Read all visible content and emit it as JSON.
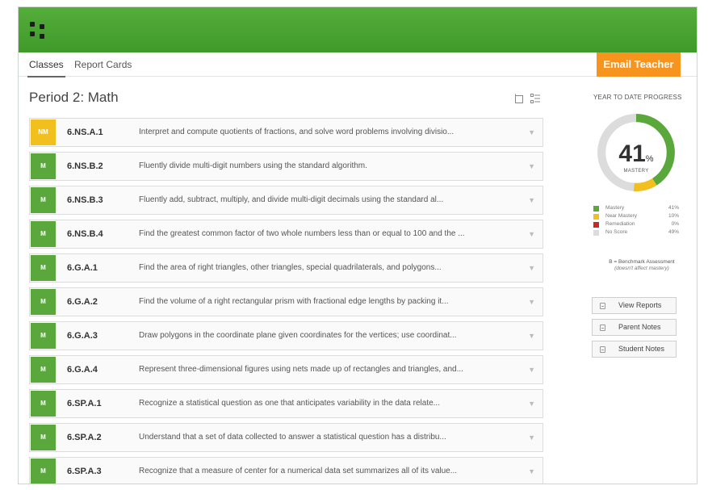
{
  "tabs": [
    {
      "label": "Classes",
      "active": true
    },
    {
      "label": "Report Cards",
      "active": false
    }
  ],
  "email_button_label": "Email Teacher",
  "page_title": "Period 2: Math",
  "standards": [
    {
      "badge": "NM",
      "color": "#f2c01e",
      "code": "6.NS.A.1",
      "description": "Interpret and compute quotients of fractions, and solve word problems involving divisio..."
    },
    {
      "badge": "M",
      "color": "#5aa83c",
      "code": "6.NS.B.2",
      "description": "Fluently divide multi-digit numbers using the standard algorithm."
    },
    {
      "badge": "M",
      "color": "#5aa83c",
      "code": "6.NS.B.3",
      "description": "Fluently add, subtract, multiply, and divide multi-digit decimals using the standard al..."
    },
    {
      "badge": "M",
      "color": "#5aa83c",
      "code": "6.NS.B.4",
      "description": "Find the greatest common factor of two whole numbers less than or equal to 100 and the ..."
    },
    {
      "badge": "M",
      "color": "#5aa83c",
      "code": "6.G.A.1",
      "description": "Find the area of right triangles, other triangles, special quadrilaterals, and polygons..."
    },
    {
      "badge": "M",
      "color": "#5aa83c",
      "code": "6.G.A.2",
      "description": "Find the volume of a right rectangular prism with fractional edge lengths by packing it..."
    },
    {
      "badge": "M",
      "color": "#5aa83c",
      "code": "6.G.A.3",
      "description": "Draw polygons in the coordinate plane given coordinates for the vertices; use coordinat..."
    },
    {
      "badge": "M",
      "color": "#5aa83c",
      "code": "6.G.A.4",
      "description": "Represent three-dimensional figures using nets made up of rectangles and triangles, and..."
    },
    {
      "badge": "M",
      "color": "#5aa83c",
      "code": "6.SP.A.1",
      "description": "Recognize a statistical question as one that anticipates variability in the data relate..."
    },
    {
      "badge": "M",
      "color": "#5aa83c",
      "code": "6.SP.A.2",
      "description": "Understand that a set of data collected to answer a statistical question has a distribu..."
    },
    {
      "badge": "M",
      "color": "#5aa83c",
      "code": "6.SP.A.3",
      "description": "Recognize that a measure of center for a numerical data set summarizes all of its value..."
    }
  ],
  "progress": {
    "title": "YEAR TO DATE PROGRESS",
    "percent": "41",
    "percent_sign": "%",
    "percent_label": "MASTERY",
    "legend": [
      {
        "name": "Mastery",
        "value": "41%",
        "color": "#5aa83c",
        "fraction": 0.41
      },
      {
        "name": "Near Mastery",
        "value": "10%",
        "color": "#f2c01e",
        "fraction": 0.1
      },
      {
        "name": "Remediation",
        "value": "0%",
        "color": "#d0281f",
        "fraction": 0.0
      },
      {
        "name": "No Score",
        "value": "49%",
        "color": "#dcdcdc",
        "fraction": 0.49
      }
    ],
    "benchmark_note": "B = Benchmark Assessment",
    "benchmark_subnote": "(doesn't affect mastery)"
  },
  "side_buttons": [
    "View Reports",
    "Parent Notes",
    "Student Notes"
  ],
  "icons": {
    "logo": "app-logo-icon",
    "view_toggle_1": "card-view-icon",
    "view_toggle_2": "list-view-icon",
    "row_expand": "chevron-down-icon",
    "side_button": "document-icon"
  }
}
